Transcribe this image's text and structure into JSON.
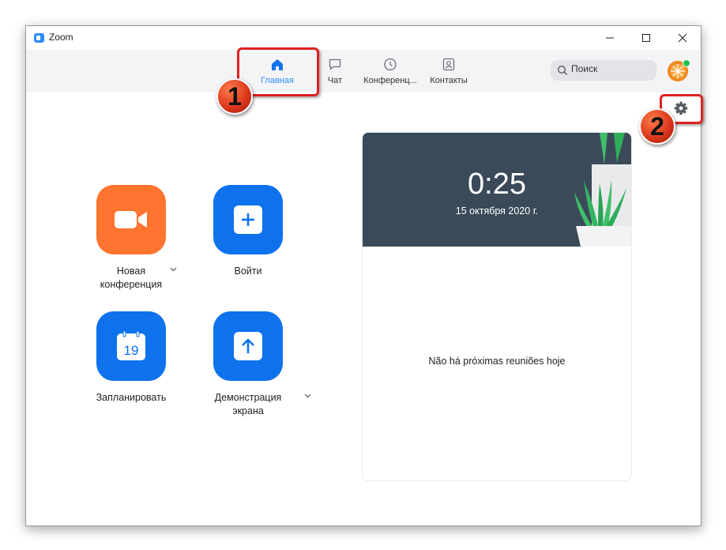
{
  "window": {
    "title": "Zoom"
  },
  "tabs": [
    {
      "label": "Главная",
      "icon": "home-icon",
      "active": true
    },
    {
      "label": "Чат",
      "icon": "chat-icon",
      "active": false
    },
    {
      "label": "Конференц...",
      "icon": "clock-icon",
      "active": false
    },
    {
      "label": "Контакты",
      "icon": "contacts-icon",
      "active": false
    }
  ],
  "search": {
    "placeholder": "Поиск"
  },
  "actions": {
    "new_meeting": {
      "label_line1": "Новая",
      "label_line2": "конференция",
      "icon": "video-camera-icon",
      "color": "#ff742e"
    },
    "join": {
      "label": "Войти",
      "icon": "plus-icon",
      "color": "#0e72ed"
    },
    "schedule": {
      "label": "Запланировать",
      "icon": "calendar-icon",
      "day": "19",
      "color": "#0e72ed"
    },
    "share": {
      "label_line1": "Демонстрация",
      "label_line2": "экрана",
      "icon": "share-arrow-icon",
      "color": "#0e72ed"
    }
  },
  "meetings_panel": {
    "time": "0:25",
    "date": "15 октября 2020 г.",
    "empty_message": "Não há próximas reuniões hoje"
  },
  "annotations": [
    {
      "number": "1",
      "target": "tab-home"
    },
    {
      "number": "2",
      "target": "settings-button"
    }
  ],
  "colors": {
    "accent": "#2d8cff",
    "annotation": "#e02020",
    "banner": "#3b4a59"
  }
}
